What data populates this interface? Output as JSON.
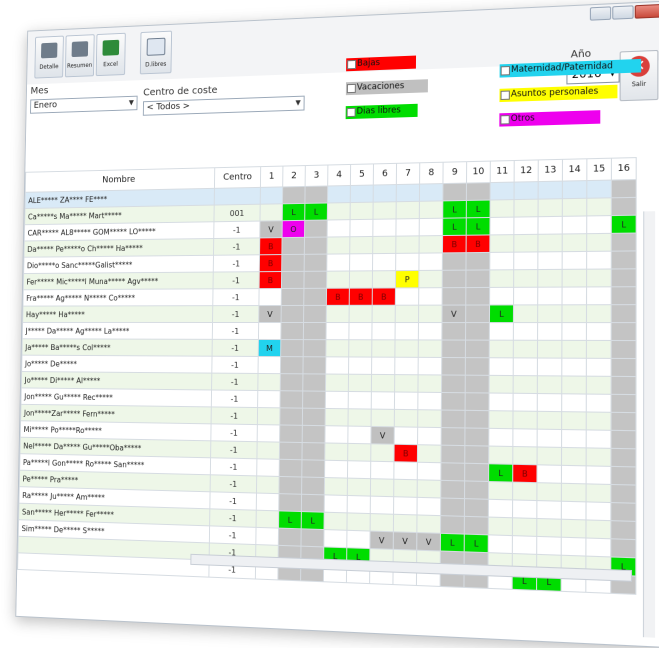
{
  "toolbar": {
    "buttons": [
      {
        "label": "Detalle",
        "icon": "printer-icon"
      },
      {
        "label": "Resumen",
        "icon": "printer-icon"
      },
      {
        "label": "Excel",
        "icon": "excel-icon"
      },
      {
        "label": "D.libres",
        "icon": "calendar-icon"
      }
    ]
  },
  "filters": {
    "mes_label": "Mes",
    "mes_value": "Enero",
    "centro_label": "Centro de coste",
    "centro_value": "< Todos >",
    "year_label": "Año",
    "year_value": "2016",
    "salir_label": "Salir"
  },
  "legend": [
    {
      "label": "Bajas",
      "color": "#ff0000"
    },
    {
      "label": "Vacaciones",
      "color": "#c0c0c0"
    },
    {
      "label": "Dias libres",
      "color": "#00dd00"
    },
    {
      "label": "Maternidad/Paternidad",
      "color": "#22d3ee"
    },
    {
      "label": "Asuntos personales",
      "color": "#ffff00"
    },
    {
      "label": "Otros",
      "color": "#ee00ee"
    }
  ],
  "cell_colors": {
    "B": "#ff0000",
    "V": "#c0c0c0",
    "L": "#00dd00",
    "M": "#22d3ee",
    "P": "#ffff00",
    "O": "#ee00ee"
  },
  "table": {
    "col_nombre": "Nombre",
    "col_centro": "Centro",
    "days": [
      "1",
      "2",
      "3",
      "4",
      "5",
      "6",
      "7",
      "8",
      "9",
      "10",
      "11",
      "12",
      "13",
      "14",
      "15",
      "16"
    ],
    "weekend_days": [
      2,
      3,
      9,
      10,
      16
    ],
    "rows": [
      {
        "name": "ALE***** ZA**** FE****",
        "centro": "",
        "cells": {}
      },
      {
        "name": "Ca*****s Ma***** Mart*****",
        "centro": "001",
        "cells": {
          "2": "L",
          "3": "L",
          "9": "L",
          "10": "L"
        }
      },
      {
        "name": "CAR***** AL8***** GOM***** LO*****",
        "centro": "-1",
        "cells": {
          "1": "V",
          "2": "O",
          "9": "L",
          "10": "L",
          "16": "L"
        }
      },
      {
        "name": "Da***** Pe*****o Ch***** Ha*****",
        "centro": "-1",
        "cells": {
          "1": "B",
          "9": "B",
          "10": "B"
        }
      },
      {
        "name": "Dio*****o Sanc*****Galist*****",
        "centro": "-1",
        "cells": {
          "1": "B"
        }
      },
      {
        "name": "Fer***** Mic*****l Muna***** Agv*****",
        "centro": "-1",
        "cells": {
          "1": "B",
          "7": "P"
        }
      },
      {
        "name": "Fra***** Ag***** N***** Co*****",
        "centro": "-1",
        "cells": {
          "4": "B",
          "5": "B",
          "6": "B"
        }
      },
      {
        "name": "Hay***** Ha*****",
        "centro": "-1",
        "cells": {
          "1": "V",
          "9": "V",
          "11": "L"
        }
      },
      {
        "name": "J***** Da***** Ag***** La*****",
        "centro": "-1",
        "cells": {}
      },
      {
        "name": "Ja***** Ba*****s Col*****",
        "centro": "-1",
        "cells": {
          "1": "M"
        }
      },
      {
        "name": "Jo***** De*****",
        "centro": "-1",
        "cells": {}
      },
      {
        "name": "Jo***** Di***** Al*****",
        "centro": "-1",
        "cells": {}
      },
      {
        "name": "Jon***** Gu***** Rec*****",
        "centro": "-1",
        "cells": {}
      },
      {
        "name": "Jon*****Zar***** Fern*****",
        "centro": "-1",
        "cells": {}
      },
      {
        "name": "Mi***** Po*****Ro*****",
        "centro": "-1",
        "cells": {
          "6": "V"
        }
      },
      {
        "name": "Nel***** Da***** Gu*****Oba*****",
        "centro": "-1",
        "cells": {
          "7": "B"
        }
      },
      {
        "name": "Pa*****l Gon***** Ro***** San*****",
        "centro": "-1",
        "cells": {
          "11": "L",
          "12": "B"
        }
      },
      {
        "name": "Pe***** Pra*****",
        "centro": "-1",
        "cells": {}
      },
      {
        "name": "Ra***** Ju***** Am*****",
        "centro": "-1",
        "cells": {}
      },
      {
        "name": "San***** Her***** Fer*****",
        "centro": "-1",
        "cells": {
          "2": "L",
          "3": "L"
        }
      },
      {
        "name": "Sim***** De***** S*****",
        "centro": "-1",
        "cells": {
          "6": "V",
          "7": "V",
          "8": "V",
          "9": "L",
          "10": "L"
        }
      },
      {
        "name": "",
        "centro": "-1",
        "cells": {
          "4": "L",
          "5": "L",
          "16": "L"
        }
      },
      {
        "name": "",
        "centro": "-1",
        "cells": {
          "12": "L",
          "13": "L"
        }
      }
    ]
  }
}
